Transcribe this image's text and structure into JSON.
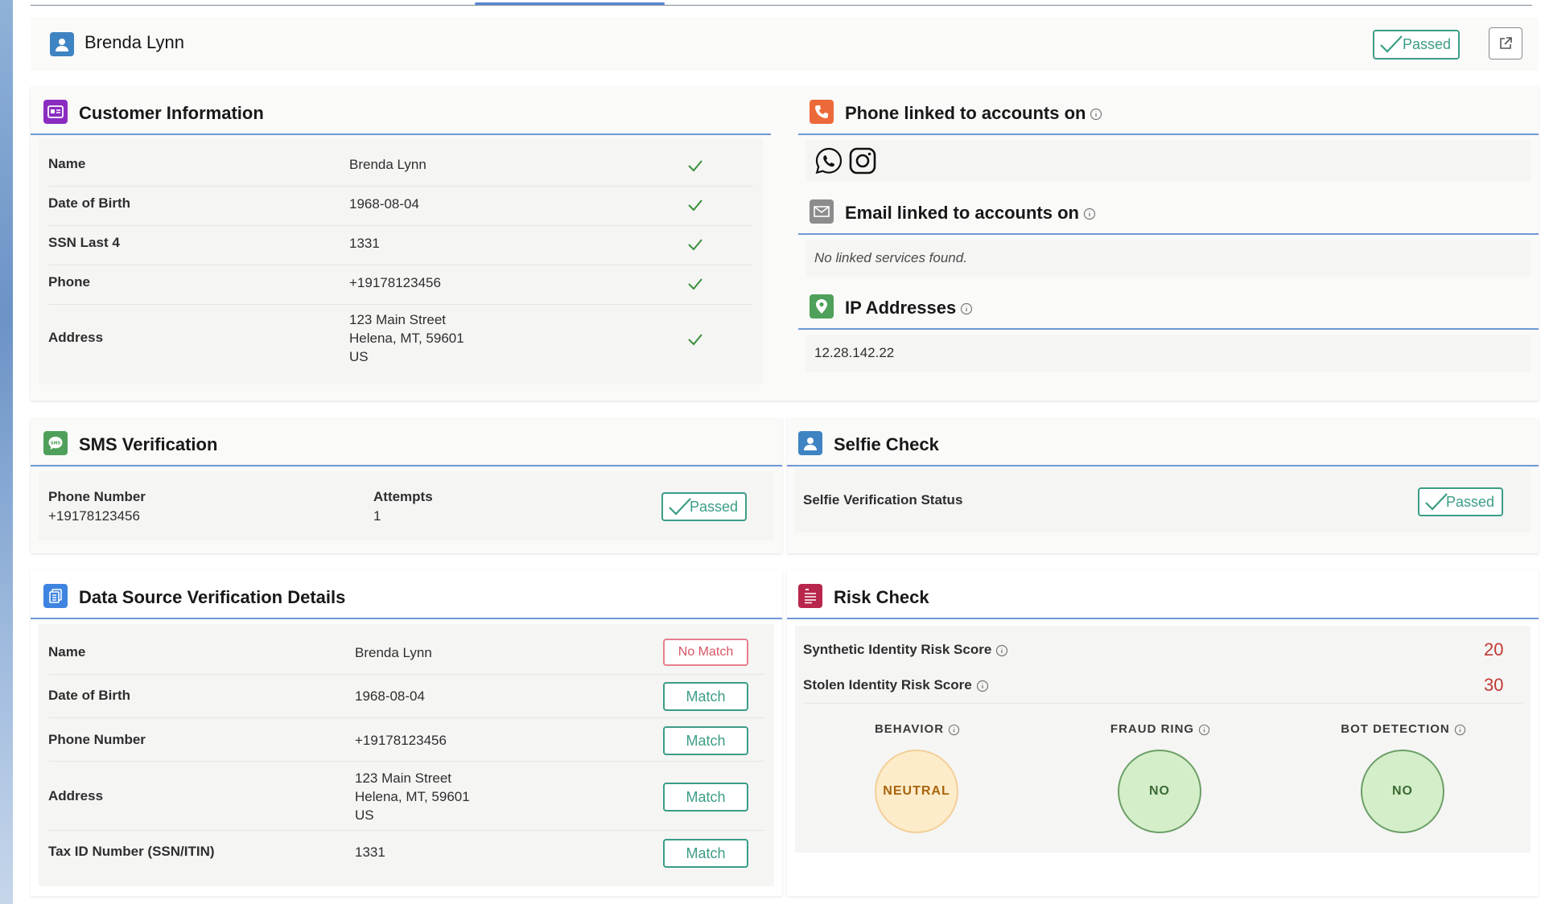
{
  "header": {
    "name": "Brenda Lynn",
    "status": "Passed"
  },
  "customer_info": {
    "title": "Customer Information",
    "rows": [
      {
        "label": "Name",
        "value": "Brenda Lynn"
      },
      {
        "label": "Date of Birth",
        "value": "1968-08-04"
      },
      {
        "label": "SSN Last 4",
        "value": "1331"
      },
      {
        "label": "Phone",
        "value": "+19178123456"
      },
      {
        "label": "Address",
        "lines": [
          "123 Main Street",
          "Helena, MT, 59601",
          "US"
        ]
      }
    ]
  },
  "phone_linked": {
    "title": "Phone linked to accounts on",
    "services": [
      "whatsapp-icon",
      "instagram-icon"
    ]
  },
  "email_linked": {
    "title": "Email linked to accounts on",
    "empty_text": "No linked services found."
  },
  "ip": {
    "title": "IP Addresses",
    "value": "12.28.142.22"
  },
  "sms": {
    "title": "SMS Verification",
    "phone_label": "Phone Number",
    "phone_value": "+19178123456",
    "attempts_label": "Attempts",
    "attempts_value": "1",
    "status": "Passed"
  },
  "selfie": {
    "title": "Selfie Check",
    "label": "Selfie Verification Status",
    "status": "Passed"
  },
  "data_source": {
    "title": "Data Source Verification Details",
    "rows": [
      {
        "label": "Name",
        "value": "Brenda Lynn",
        "result": "No Match"
      },
      {
        "label": "Date of Birth",
        "value": "1968-08-04",
        "result": "Match"
      },
      {
        "label": "Phone Number",
        "value": "+19178123456",
        "result": "Match"
      },
      {
        "label": "Address",
        "lines": [
          "123 Main Street",
          "Helena, MT, 59601",
          "US"
        ],
        "result": "Match"
      },
      {
        "label": "Tax ID Number (SSN/ITIN)",
        "value": "1331",
        "result": "Match"
      }
    ]
  },
  "risk": {
    "title": "Risk Check",
    "synthetic_label": "Synthetic Identity Risk Score",
    "synthetic_score": "20",
    "stolen_label": "Stolen Identity Risk Score",
    "stolen_score": "30",
    "indicators": [
      {
        "label": "BEHAVIOR",
        "value": "NEUTRAL"
      },
      {
        "label": "FRAUD RING",
        "value": "NO"
      },
      {
        "label": "BOT DETECTION",
        "value": "NO"
      }
    ]
  },
  "colors": {
    "accent_line": "#6e97d8",
    "match": "#3b9d87",
    "no_match": "#d85766",
    "score": "#c23934"
  }
}
